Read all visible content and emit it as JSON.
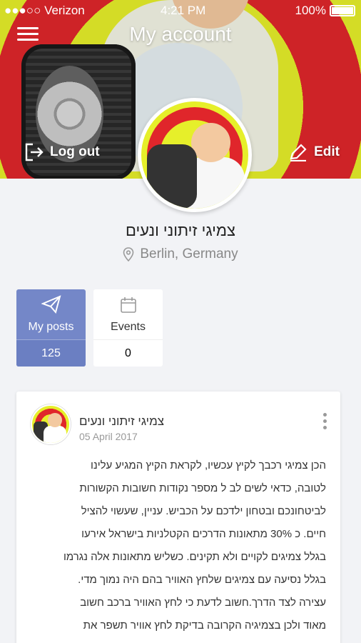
{
  "status_bar": {
    "carrier": "●●●○○ Verizon",
    "time": "4:21 PM",
    "battery": "100%"
  },
  "header": {
    "title": "My account",
    "logout_label": "Log out",
    "edit_label": "Edit"
  },
  "profile": {
    "name": "צמיגי זיתוני ונעים",
    "location": "Berlin, Germany"
  },
  "stats": [
    {
      "label": "My posts",
      "value": "125",
      "icon": "paper-plane-icon",
      "active": true
    },
    {
      "label": "Events",
      "value": "0",
      "icon": "calendar-icon",
      "active": false
    }
  ],
  "post": {
    "author": "צמיגי זיתוני ונעים",
    "date": "05 April 2017",
    "lines": [
      "הכן צמיגי רכבך לקיץ  עכשיו, לקראת הקיץ המגיע עלינו",
      "לטובה, כדאי לשים לב ל מספר נקודות חשובות הקשורות",
      "לביטחונכם ובטחון ילדכם על הכביש. עניין, שעשוי להציל",
      "חיים. כ 30% מתאונות הדרכים הקטלניות בישראל אירעו",
      "בגלל צמיגים לקויים ולא תקינים. כשליש מתאונות אלה נגרמו",
      "בגלל נסיעה עם צמיגים שלחץ האוויר בהם היה נמוך מדי.",
      "עצירה לצד הדרך.חשוב לדעת כי לחץ האוויר ברכב חשוב",
      "מאוד ולכן בצמיגיה הקרובה בדיקת לחץ אוויר תשפר את"
    ]
  },
  "colors": {
    "accent": "#7487c8",
    "background": "#f2f3f6"
  }
}
